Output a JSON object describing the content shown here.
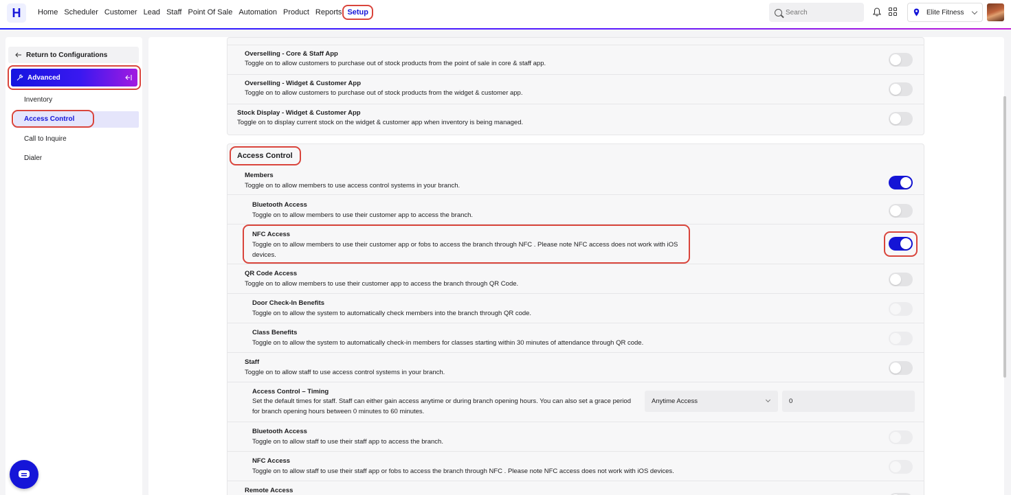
{
  "app": {
    "logo_letter": "H"
  },
  "nav": {
    "items": [
      "Home",
      "Scheduler",
      "Customer",
      "Lead",
      "Staff",
      "Point Of Sale",
      "Automation",
      "Product",
      "Reports"
    ],
    "active": "Setup"
  },
  "search": {
    "placeholder": "Search"
  },
  "branch": {
    "name": "Elite Fitness"
  },
  "sidebar": {
    "return_label": "Return to Configurations",
    "section": "Advanced",
    "items": [
      "Inventory",
      "Access Control",
      "Call to Inquire",
      "Dialer"
    ],
    "active_item": "Access Control"
  },
  "stock_rows": [
    {
      "title": "Overselling - Core & Staff App",
      "desc": "Toggle on to allow customers to purchase out of stock products from the point of sale in core & staff app.",
      "on": false
    },
    {
      "title": "Overselling - Widget & Customer App",
      "desc": "Toggle on to allow customers to purchase out of stock products from the widget & customer app.",
      "on": false
    },
    {
      "title": "Stock Display - Widget & Customer App",
      "desc": "Toggle on to display current stock on the widget & customer app when inventory is being managed.",
      "on": false
    }
  ],
  "access_control": {
    "heading": "Access Control",
    "rows": [
      {
        "title": "Members",
        "desc": "Toggle on to allow members to use access control systems in your branch.",
        "state": "on"
      },
      {
        "title": "Bluetooth Access",
        "desc": "Toggle on to allow members to use their customer app to access the branch.",
        "state": "off"
      },
      {
        "title": "NFC Access",
        "desc": "Toggle on to allow members to use their customer app or fobs to access the branch through NFC . Please note NFC access does not work with iOS devices.",
        "state": "on"
      },
      {
        "title": "QR Code Access",
        "desc": "Toggle on to allow members to use their customer app to access the branch through QR Code.",
        "state": "off"
      },
      {
        "title": "Door Check-In Benefits",
        "desc": "Toggle on to allow the system to automatically check members into the branch through QR code.",
        "state": "disabled"
      },
      {
        "title": "Class Benefits",
        "desc": "Toggle on to allow the system to automatically check-in members for classes starting within 30 minutes of attendance through QR code.",
        "state": "disabled"
      },
      {
        "title": "Staff",
        "desc": "Toggle on to allow staff to use access control systems in your branch.",
        "state": "off"
      },
      {
        "title": "Access Control – Timing",
        "desc": "Set the default times for staff. Staff can either gain access anytime or during branch opening hours. You can also set a grace period for branch opening hours between 0 minutes to 60 minutes."
      },
      {
        "title": "Bluetooth Access",
        "desc": "Toggle on to allow staff to use their staff app to access the branch.",
        "state": "disabled"
      },
      {
        "title": "NFC Access",
        "desc": "Toggle on to allow staff to use their staff app or fobs to access the branch through NFC . Please note NFC access does not work with iOS devices.",
        "state": "disabled"
      },
      {
        "title": "Remote Access",
        "state": "off"
      }
    ],
    "timing_select": "Anytime Access",
    "grace_minutes": "0"
  },
  "colors": {
    "primary": "#1515d8",
    "highlight_ring": "#d9443b",
    "toggle_off": "#e3e3e5"
  },
  "icons": [
    "search-icon",
    "bell-icon",
    "apps-grid-icon",
    "location-pin-icon",
    "chevron-down-icon",
    "back-arrow-icon",
    "wrench-icon",
    "collapse-icon",
    "chat-icon"
  ]
}
